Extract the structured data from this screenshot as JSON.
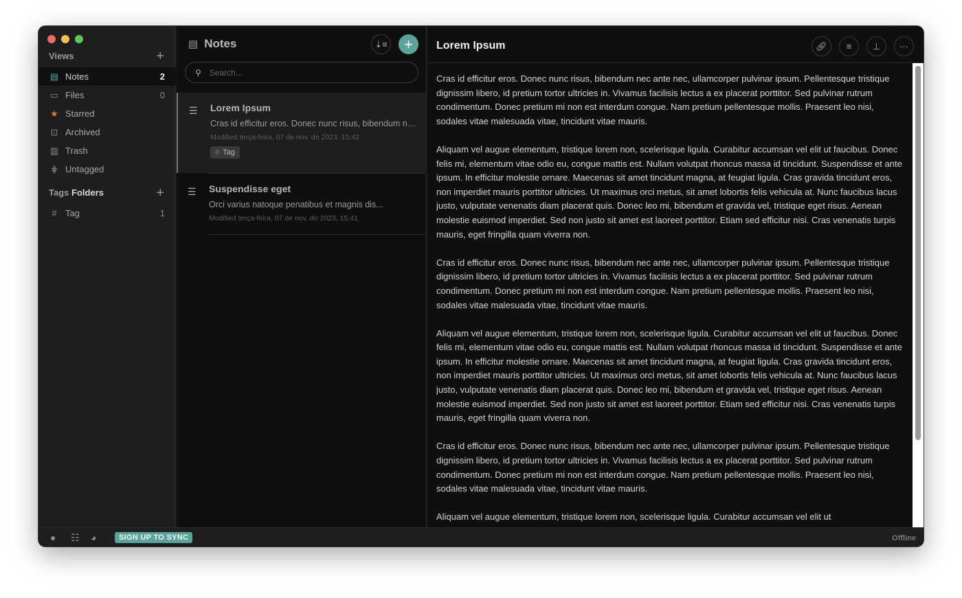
{
  "sidebar": {
    "views_title": "Views",
    "items": [
      {
        "label": "Notes",
        "count": "2",
        "icon": "notes-icon"
      },
      {
        "label": "Files",
        "count": "0",
        "icon": "folder-icon"
      },
      {
        "label": "Starred",
        "count": "",
        "icon": "star-icon"
      },
      {
        "label": "Archived",
        "count": "",
        "icon": "archive-icon"
      },
      {
        "label": "Trash",
        "count": "",
        "icon": "trash-icon"
      },
      {
        "label": "Untagged",
        "count": "",
        "icon": "untagged-icon"
      }
    ],
    "tags_title": "Tags",
    "folders_title": "Folders",
    "tags": [
      {
        "label": "Tag",
        "count": "1"
      }
    ]
  },
  "list": {
    "title": "Notes",
    "search_placeholder": "Search...",
    "notes": [
      {
        "title": "Lorem Ipsum",
        "preview": "Cras id efficitur eros. Donec nunc risus, bibendum nec ante nec, ullamcorper pulvinar ipsum.",
        "modified": "Modified terça-feira, 07 de nov. de 2023, 15:42",
        "tag": "Tag"
      },
      {
        "title": "Suspendisse eget",
        "preview": "Orci varius natoque penatibus et magnis dis...",
        "modified": "Modified terça-feira, 07 de nov. de 2023, 15:41"
      }
    ]
  },
  "editor": {
    "title": "Lorem Ipsum",
    "paragraphs": [
      "Cras id efficitur eros. Donec nunc risus, bibendum nec ante nec, ullamcorper pulvinar ipsum. Pellentesque tristique dignissim libero, id pretium tortor ultricies in. Vivamus facilisis lectus a ex placerat porttitor. Sed pulvinar rutrum condimentum. Donec pretium mi non est interdum congue. Nam pretium pellentesque mollis. Praesent leo nisi, sodales vitae malesuada vitae, tincidunt vitae mauris.",
      "Aliquam vel augue elementum, tristique lorem non, scelerisque ligula. Curabitur accumsan vel elit ut faucibus. Donec felis mi, elementum vitae odio eu, congue mattis est. Nullam volutpat rhoncus massa id tincidunt. Suspendisse et ante ipsum. In efficitur molestie ornare. Maecenas sit amet tincidunt magna, at feugiat ligula. Cras gravida tincidunt eros, non imperdiet mauris porttitor ultricies. Ut maximus orci metus, sit amet lobortis felis vehicula at. Nunc faucibus lacus justo, vulputate venenatis diam placerat quis. Donec leo mi, bibendum et gravida vel, tristique eget risus. Aenean molestie euismod imperdiet. Sed non justo sit amet est laoreet porttitor. Etiam sed efficitur nisi. Cras venenatis turpis mauris, eget fringilla quam viverra non.",
      "Cras id efficitur eros. Donec nunc risus, bibendum nec ante nec, ullamcorper pulvinar ipsum. Pellentesque tristique dignissim libero, id pretium tortor ultricies in. Vivamus facilisis lectus a ex placerat porttitor. Sed pulvinar rutrum condimentum. Donec pretium mi non est interdum congue. Nam pretium pellentesque mollis. Praesent leo nisi, sodales vitae malesuada vitae, tincidunt vitae mauris.",
      "Aliquam vel augue elementum, tristique lorem non, scelerisque ligula. Curabitur accumsan vel elit ut faucibus. Donec felis mi, elementum vitae odio eu, congue mattis est. Nullam volutpat rhoncus massa id tincidunt. Suspendisse et ante ipsum. In efficitur molestie ornare. Maecenas sit amet tincidunt magna, at feugiat ligula. Cras gravida tincidunt eros, non imperdiet mauris porttitor ultricies. Ut maximus orci metus, sit amet lobortis felis vehicula at. Nunc faucibus lacus justo, vulputate venenatis diam placerat quis. Donec leo mi, bibendum et gravida vel, tristique eget risus. Aenean molestie euismod imperdiet. Sed non justo sit amet est laoreet porttitor. Etiam sed efficitur nisi. Cras venenatis turpis mauris, eget fringilla quam viverra non.",
      "Cras id efficitur eros. Donec nunc risus, bibendum nec ante nec, ullamcorper pulvinar ipsum. Pellentesque tristique dignissim libero, id pretium tortor ultricies in. Vivamus facilisis lectus a ex placerat porttitor. Sed pulvinar rutrum condimentum. Donec pretium mi non est interdum congue. Nam pretium pellentesque mollis. Praesent leo nisi, sodales vitae malesuada vitae, tincidunt vitae mauris.",
      "Aliquam vel augue elementum, tristique lorem non, scelerisque ligula. Curabitur accumsan vel elit ut"
    ]
  },
  "footer": {
    "sync_label": "SIGN UP TO SYNC",
    "status": "Offline"
  },
  "colors": {
    "accent": "#5aa59b",
    "star": "#e07b39",
    "close": "#ed6a5e",
    "minimize": "#f5bf4f",
    "maximize": "#61c554"
  }
}
